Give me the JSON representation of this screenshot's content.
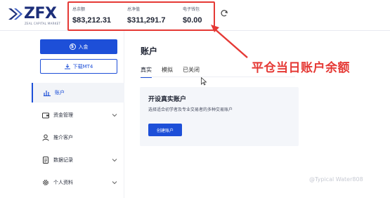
{
  "brand": {
    "logo_text": "ZFX",
    "logo_subtitle": "ZEAL CAPITAL MARKET"
  },
  "header": {
    "balances": [
      {
        "label": "总余额",
        "value": "$83,212.31"
      },
      {
        "label": "总净值",
        "value": "$311,291.7"
      },
      {
        "label": "电子钱包",
        "value": "$0.00"
      }
    ],
    "refresh_icon": "refresh-icon"
  },
  "sidebar": {
    "deposit_label": "入金",
    "download_label": "下载MT4",
    "items": [
      {
        "label": "账户",
        "icon": "chart-icon",
        "active": true,
        "has_chevron": false
      },
      {
        "label": "资金管理",
        "icon": "wallet-icon",
        "active": false,
        "has_chevron": true
      },
      {
        "label": "推介客户",
        "icon": "user-icon",
        "active": false,
        "has_chevron": false
      },
      {
        "label": "数据记录",
        "icon": "document-icon",
        "active": false,
        "has_chevron": true
      },
      {
        "label": "个人资料",
        "icon": "gear-icon",
        "active": false,
        "has_chevron": true
      }
    ]
  },
  "main": {
    "title": "账户",
    "tabs": [
      {
        "label": "真实",
        "active": true
      },
      {
        "label": "模拟",
        "active": false
      },
      {
        "label": "已关闭",
        "active": false
      }
    ],
    "card": {
      "title": "开设真实账户",
      "description": "选择适合初学者及专业交易者的多种交易账户",
      "button_label": "创建账户"
    }
  },
  "annotation": {
    "text": "平仓当日账户余额",
    "color": "#e53935"
  },
  "watermark": "@Typical Water808",
  "colors": {
    "primary": "#1d4fd8",
    "brand": "#1d2f7a",
    "annotation": "#e53935"
  }
}
